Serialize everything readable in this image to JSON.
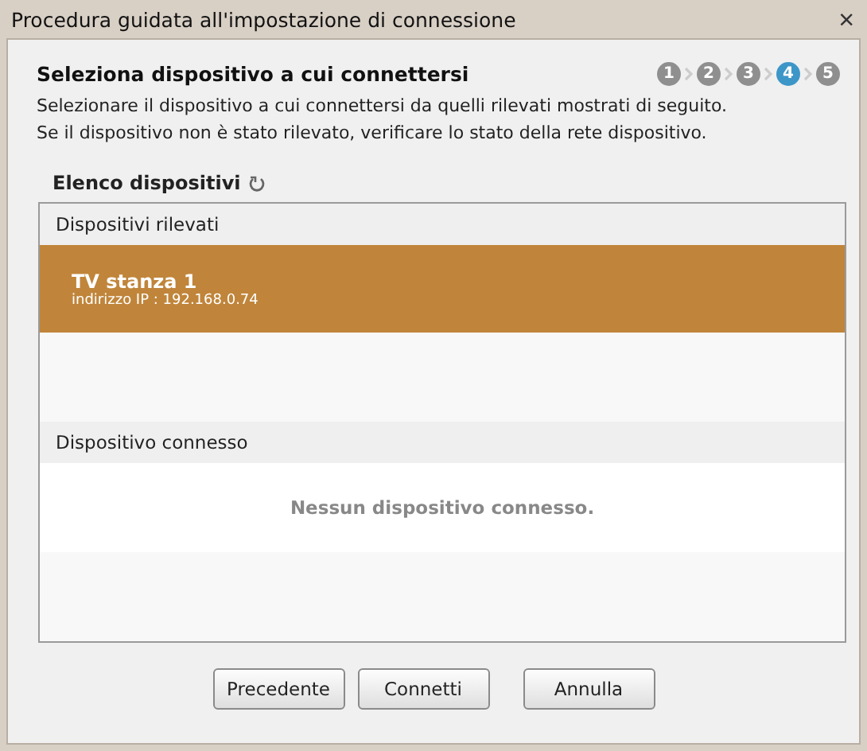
{
  "window": {
    "title": "Procedura guidata all'impostazione di connessione",
    "close": "×"
  },
  "heading": "Seleziona dispositivo a cui connettersi",
  "steps": [
    {
      "label": "1",
      "selected": false
    },
    {
      "label": "2",
      "selected": false
    },
    {
      "label": "3",
      "selected": false
    },
    {
      "label": "4",
      "selected": true
    },
    {
      "label": "5",
      "selected": false
    }
  ],
  "instructions": [
    "Selezionare il dispositivo a cui connettersi da quelli rilevati mostrati di seguito.",
    "Se il dispositivo non è stato rilevato, verificare lo stato della rete dispositivo."
  ],
  "device_list": {
    "title": "Elenco dispositivi",
    "detected": {
      "header": "Dispositivi rilevati",
      "devices": [
        {
          "name": "TV stanza 1",
          "address": "indirizzo IP : 192.168.0.74",
          "selected": true
        }
      ]
    },
    "connected": {
      "header": "Dispositivo connesso",
      "empty_message": "Nessun dispositivo connesso."
    }
  },
  "buttons": [
    "Precedente",
    "Connetti",
    "Annulla"
  ]
}
